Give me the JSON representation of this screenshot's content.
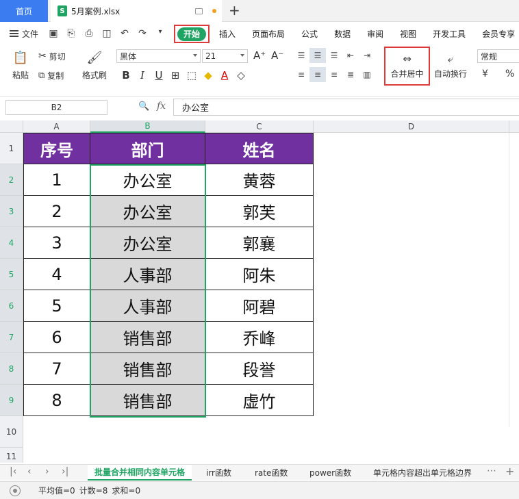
{
  "tabs": {
    "home": "首页",
    "file": "5月案例.xlsx"
  },
  "menu": {
    "file": "文件",
    "items": [
      "开始",
      "插入",
      "页面布局",
      "公式",
      "数据",
      "审阅",
      "视图",
      "开发工具",
      "会员专享"
    ]
  },
  "ribbon": {
    "paste": "粘贴",
    "cut": "剪切",
    "copy": "复制",
    "format_painter": "格式刷",
    "font_name": "黑体",
    "font_size": "21",
    "merge_center": "合并居中",
    "wrap_text": "自动换行",
    "number_format": "常规",
    "currency_symbol": "¥",
    "percent_symbol": "%",
    "colors": {
      "accent": "#1fa463",
      "highlight_frame": "#e03b3b",
      "header_fill": "#7030a0"
    }
  },
  "formula_bar": {
    "cell_ref": "B2",
    "fx": "fx",
    "value": "办公室"
  },
  "columns": [
    "A",
    "B",
    "C",
    "D"
  ],
  "rows": [
    "1",
    "2",
    "3",
    "4",
    "5",
    "6",
    "7",
    "8",
    "9",
    "10",
    "11"
  ],
  "table": {
    "headers": [
      "序号",
      "部门",
      "姓名"
    ],
    "data": [
      [
        "1",
        "办公室",
        "黄蓉"
      ],
      [
        "2",
        "办公室",
        "郭芙"
      ],
      [
        "3",
        "办公室",
        "郭襄"
      ],
      [
        "4",
        "人事部",
        "阿朱"
      ],
      [
        "5",
        "人事部",
        "阿碧"
      ],
      [
        "6",
        "销售部",
        "乔峰"
      ],
      [
        "7",
        "销售部",
        "段誉"
      ],
      [
        "8",
        "销售部",
        "虚竹"
      ]
    ]
  },
  "sheets": [
    "批量合并相同内容单元格",
    "irr函数",
    "rate函数",
    "power函数",
    "单元格内容超出单元格边界"
  ],
  "status": {
    "average": "平均值=0",
    "count": "计数=8",
    "sum": "求和=0"
  }
}
